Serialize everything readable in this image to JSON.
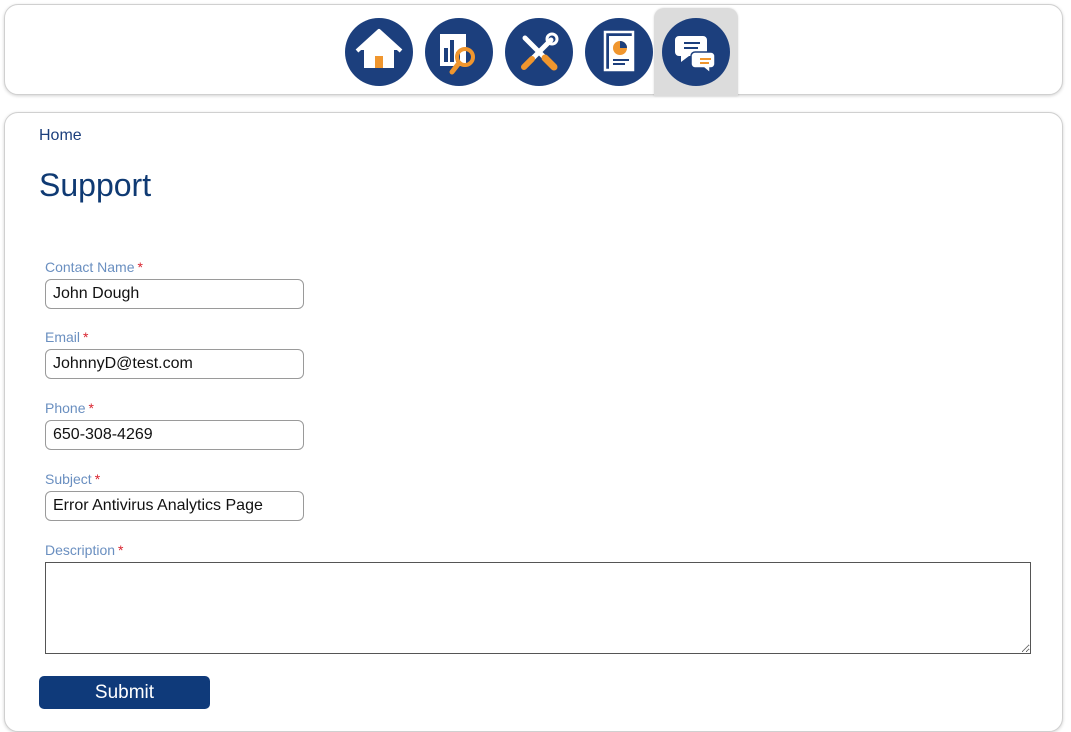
{
  "nav": {
    "items": [
      {
        "icon": "home-icon"
      },
      {
        "icon": "analytics-search-icon"
      },
      {
        "icon": "tools-icon"
      },
      {
        "icon": "report-chart-icon"
      },
      {
        "icon": "chat-support-icon",
        "active": true
      }
    ],
    "colors": {
      "icon_bg": "#1c3f7d",
      "accent": "#f0962e",
      "active_bg": "#dcdcdc"
    }
  },
  "breadcrumb": {
    "home": "Home"
  },
  "page": {
    "title": "Support"
  },
  "form": {
    "required_mark": "*",
    "contact_name": {
      "label": "Contact Name",
      "value": "John Dough"
    },
    "email": {
      "label": "Email",
      "value": "JohnnyD@test.com"
    },
    "phone": {
      "label": "Phone",
      "value": "650-308-4269"
    },
    "subject": {
      "label": "Subject",
      "value": "Error Antivirus Analytics Page"
    },
    "description": {
      "label": "Description",
      "value": ""
    },
    "submit_label": "Submit"
  }
}
